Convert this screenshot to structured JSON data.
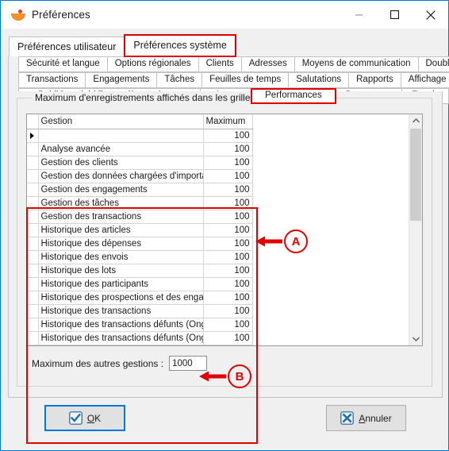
{
  "window": {
    "title": "Préférences",
    "icon": "app-bird-icon",
    "controls": {
      "minimize": "minimize-icon",
      "maximize": "maximize-icon",
      "close": "close-icon"
    }
  },
  "main_tabs": [
    {
      "label": "Préférences utilisateur",
      "selected": false,
      "highlighted": false
    },
    {
      "label": "Préférences système",
      "selected": true,
      "highlighted": true
    }
  ],
  "sub_tab_rows": [
    [
      {
        "label": "Sécurité et langue"
      },
      {
        "label": "Options régionales"
      },
      {
        "label": "Clients"
      },
      {
        "label": "Adresses"
      },
      {
        "label": "Moyens de communication"
      },
      {
        "label": "Doublons"
      }
    ],
    [
      {
        "label": "Transactions"
      },
      {
        "label": "Engagements"
      },
      {
        "label": "Tâches"
      },
      {
        "label": "Feuilles de temps"
      },
      {
        "label": "Salutations"
      },
      {
        "label": "Rapports"
      },
      {
        "label": "Affichage"
      }
    ],
    [
      {
        "label": "PubliCourriel / Reçus électroniques"
      },
      {
        "label": "Autre"
      },
      {
        "label": "Performances",
        "highlighted": true,
        "selected": true
      },
      {
        "label": "Documents"
      },
      {
        "label": "Envois"
      }
    ]
  ],
  "group": {
    "legend": "Maximum d'enregistrements affichés dans les grilles de gestion"
  },
  "grid": {
    "columns": [
      "Gestion",
      "Maximum"
    ],
    "rows": [
      {
        "selected": true,
        "gestion": "",
        "maximum": "100"
      },
      {
        "selected": false,
        "gestion": "Analyse avancée",
        "maximum": "100"
      },
      {
        "selected": false,
        "gestion": "Gestion des clients",
        "maximum": "100"
      },
      {
        "selected": false,
        "gestion": "Gestion des données chargées d'importation",
        "maximum": "100"
      },
      {
        "selected": false,
        "gestion": "Gestion des engagements",
        "maximum": "100"
      },
      {
        "selected": false,
        "gestion": "Gestion des tâches",
        "maximum": "100"
      },
      {
        "selected": false,
        "gestion": "Gestion des transactions",
        "maximum": "100"
      },
      {
        "selected": false,
        "gestion": "Historique des articles",
        "maximum": "100"
      },
      {
        "selected": false,
        "gestion": "Historique des dépenses",
        "maximum": "100"
      },
      {
        "selected": false,
        "gestion": "Historique des envois",
        "maximum": "100"
      },
      {
        "selected": false,
        "gestion": "Historique des lots",
        "maximum": "100"
      },
      {
        "selected": false,
        "gestion": "Historique des participants",
        "maximum": "100"
      },
      {
        "selected": false,
        "gestion": "Historique des prospections et des engagem",
        "maximum": "100"
      },
      {
        "selected": false,
        "gestion": "Historique des transactions",
        "maximum": "100"
      },
      {
        "selected": false,
        "gestion": "Historique des transactions défunts (Onglet",
        "maximum": "100"
      },
      {
        "selected": false,
        "gestion": "Historique des transactions défunts (Onglet",
        "maximum": "100"
      }
    ],
    "scrollbar": {
      "up": "▲",
      "down": "▼"
    }
  },
  "other_gestions": {
    "label": "Maximum des autres gestions :",
    "value": "1000",
    "placeholder": ""
  },
  "footer": {
    "ok": {
      "label_pre": "",
      "label_underline": "O",
      "label_post": "K",
      "icon": "checkmark-icon"
    },
    "cancel": {
      "label_pre": "",
      "label_underline": "A",
      "label_post": "nnuler",
      "icon": "cross-icon"
    }
  },
  "annotations": [
    {
      "id": "A",
      "letter": "A"
    },
    {
      "id": "B",
      "letter": "B"
    }
  ],
  "colors": {
    "accent": "#0078d7",
    "annotation": "#e00000",
    "window_bg": "#f0f0f0",
    "grid_bg": "#ffffff"
  }
}
